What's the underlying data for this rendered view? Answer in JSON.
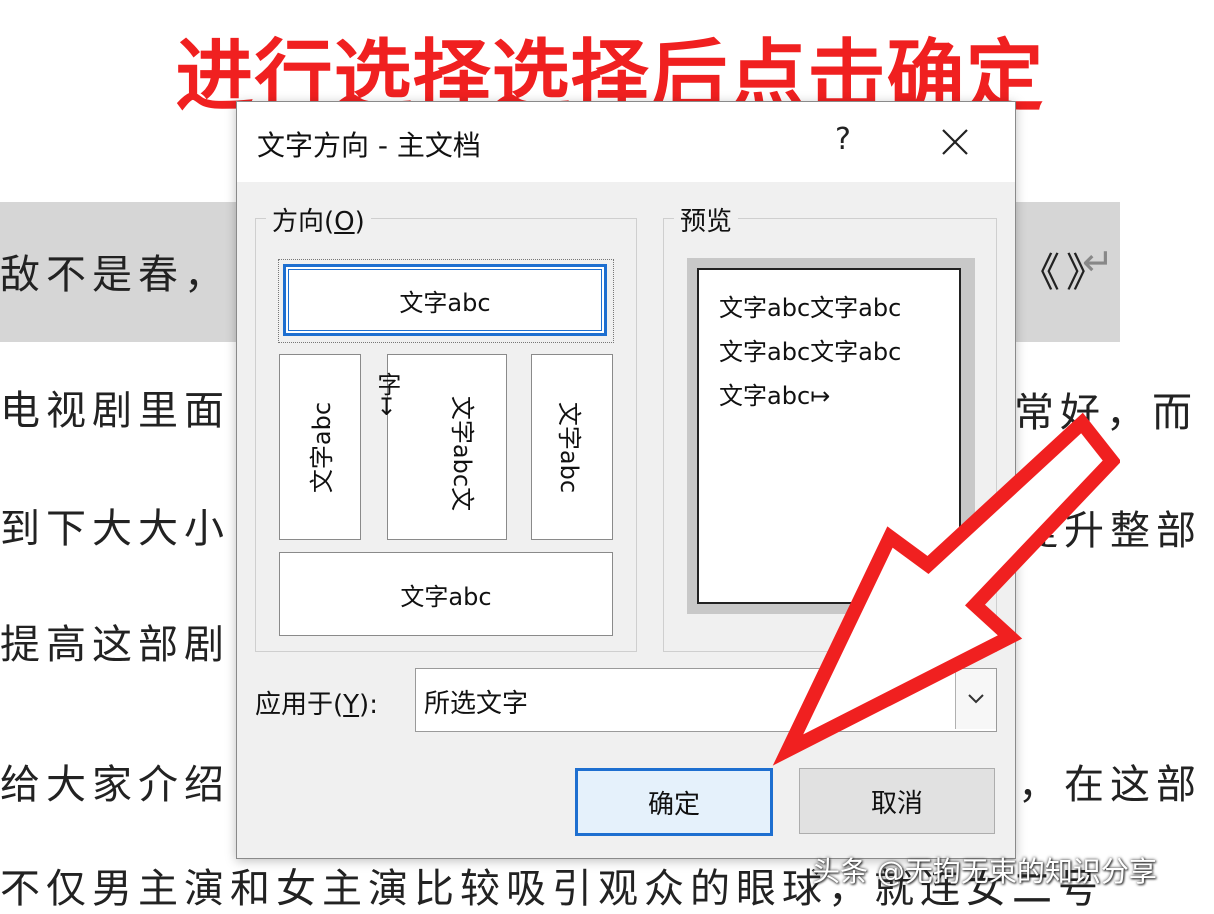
{
  "annotation": "进行选择选择后点击确定",
  "document": {
    "lines": [
      "敌不是春，",
      "电视剧里面",
      "到下大大小",
      "提高这部剧",
      "给大家介绍",
      "不仅男主演和女主演比较吸引观众的眼球，就连女二号"
    ],
    "right_fragments": [
      "《》",
      "常好，而",
      "提升整部",
      "，在这部"
    ],
    "para_mark": "↵"
  },
  "watermark": "头条 @无拘无束的知识分享",
  "dialog": {
    "title": "文字方向 - 主文档",
    "help": "?",
    "direction_group": {
      "label_prefix": "方向(",
      "label_key": "O",
      "label_suffix": ")",
      "options": {
        "horizontal": "文字abc",
        "rotate_down": "文字abc",
        "stacked_col1": "字↦",
        "stacked_col2": "文字abc文",
        "rotate_up": "文字abc",
        "horizontal_mirror": "文字abc"
      }
    },
    "preview_group": {
      "label": "预览",
      "lines": [
        "文字abc文字abc",
        "文字abc文字abc",
        "文字abc↦"
      ]
    },
    "apply": {
      "label_prefix": "应用于(",
      "label_key": "Y",
      "label_suffix": "):",
      "value": "所选文字"
    },
    "ok_label": "确定",
    "cancel_label": "取消"
  },
  "colors": {
    "accent": "#1e6fd0",
    "annotation": "#f02020"
  }
}
